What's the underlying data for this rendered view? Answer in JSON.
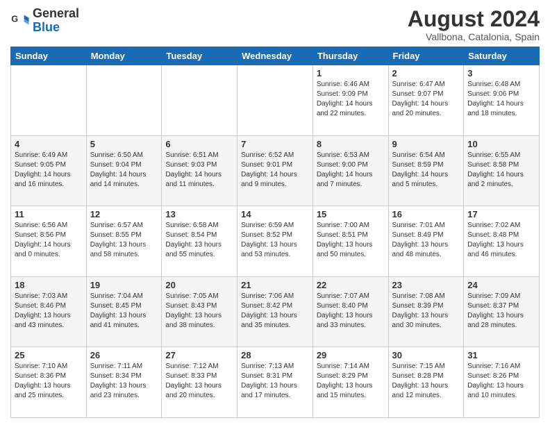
{
  "header": {
    "logo_general": "General",
    "logo_blue": "Blue",
    "month_title": "August 2024",
    "location": "Vallbona, Catalonia, Spain"
  },
  "days_of_week": [
    "Sunday",
    "Monday",
    "Tuesday",
    "Wednesday",
    "Thursday",
    "Friday",
    "Saturday"
  ],
  "weeks": [
    [
      {
        "day": "",
        "info": ""
      },
      {
        "day": "",
        "info": ""
      },
      {
        "day": "",
        "info": ""
      },
      {
        "day": "",
        "info": ""
      },
      {
        "day": "1",
        "info": "Sunrise: 6:46 AM\nSunset: 9:09 PM\nDaylight: 14 hours and 22 minutes."
      },
      {
        "day": "2",
        "info": "Sunrise: 6:47 AM\nSunset: 9:07 PM\nDaylight: 14 hours and 20 minutes."
      },
      {
        "day": "3",
        "info": "Sunrise: 6:48 AM\nSunset: 9:06 PM\nDaylight: 14 hours and 18 minutes."
      }
    ],
    [
      {
        "day": "4",
        "info": "Sunrise: 6:49 AM\nSunset: 9:05 PM\nDaylight: 14 hours and 16 minutes."
      },
      {
        "day": "5",
        "info": "Sunrise: 6:50 AM\nSunset: 9:04 PM\nDaylight: 14 hours and 14 minutes."
      },
      {
        "day": "6",
        "info": "Sunrise: 6:51 AM\nSunset: 9:03 PM\nDaylight: 14 hours and 11 minutes."
      },
      {
        "day": "7",
        "info": "Sunrise: 6:52 AM\nSunset: 9:01 PM\nDaylight: 14 hours and 9 minutes."
      },
      {
        "day": "8",
        "info": "Sunrise: 6:53 AM\nSunset: 9:00 PM\nDaylight: 14 hours and 7 minutes."
      },
      {
        "day": "9",
        "info": "Sunrise: 6:54 AM\nSunset: 8:59 PM\nDaylight: 14 hours and 5 minutes."
      },
      {
        "day": "10",
        "info": "Sunrise: 6:55 AM\nSunset: 8:58 PM\nDaylight: 14 hours and 2 minutes."
      }
    ],
    [
      {
        "day": "11",
        "info": "Sunrise: 6:56 AM\nSunset: 8:56 PM\nDaylight: 14 hours and 0 minutes."
      },
      {
        "day": "12",
        "info": "Sunrise: 6:57 AM\nSunset: 8:55 PM\nDaylight: 13 hours and 58 minutes."
      },
      {
        "day": "13",
        "info": "Sunrise: 6:58 AM\nSunset: 8:54 PM\nDaylight: 13 hours and 55 minutes."
      },
      {
        "day": "14",
        "info": "Sunrise: 6:59 AM\nSunset: 8:52 PM\nDaylight: 13 hours and 53 minutes."
      },
      {
        "day": "15",
        "info": "Sunrise: 7:00 AM\nSunset: 8:51 PM\nDaylight: 13 hours and 50 minutes."
      },
      {
        "day": "16",
        "info": "Sunrise: 7:01 AM\nSunset: 8:49 PM\nDaylight: 13 hours and 48 minutes."
      },
      {
        "day": "17",
        "info": "Sunrise: 7:02 AM\nSunset: 8:48 PM\nDaylight: 13 hours and 46 minutes."
      }
    ],
    [
      {
        "day": "18",
        "info": "Sunrise: 7:03 AM\nSunset: 8:46 PM\nDaylight: 13 hours and 43 minutes."
      },
      {
        "day": "19",
        "info": "Sunrise: 7:04 AM\nSunset: 8:45 PM\nDaylight: 13 hours and 41 minutes."
      },
      {
        "day": "20",
        "info": "Sunrise: 7:05 AM\nSunset: 8:43 PM\nDaylight: 13 hours and 38 minutes."
      },
      {
        "day": "21",
        "info": "Sunrise: 7:06 AM\nSunset: 8:42 PM\nDaylight: 13 hours and 35 minutes."
      },
      {
        "day": "22",
        "info": "Sunrise: 7:07 AM\nSunset: 8:40 PM\nDaylight: 13 hours and 33 minutes."
      },
      {
        "day": "23",
        "info": "Sunrise: 7:08 AM\nSunset: 8:39 PM\nDaylight: 13 hours and 30 minutes."
      },
      {
        "day": "24",
        "info": "Sunrise: 7:09 AM\nSunset: 8:37 PM\nDaylight: 13 hours and 28 minutes."
      }
    ],
    [
      {
        "day": "25",
        "info": "Sunrise: 7:10 AM\nSunset: 8:36 PM\nDaylight: 13 hours and 25 minutes."
      },
      {
        "day": "26",
        "info": "Sunrise: 7:11 AM\nSunset: 8:34 PM\nDaylight: 13 hours and 23 minutes."
      },
      {
        "day": "27",
        "info": "Sunrise: 7:12 AM\nSunset: 8:33 PM\nDaylight: 13 hours and 20 minutes."
      },
      {
        "day": "28",
        "info": "Sunrise: 7:13 AM\nSunset: 8:31 PM\nDaylight: 13 hours and 17 minutes."
      },
      {
        "day": "29",
        "info": "Sunrise: 7:14 AM\nSunset: 8:29 PM\nDaylight: 13 hours and 15 minutes."
      },
      {
        "day": "30",
        "info": "Sunrise: 7:15 AM\nSunset: 8:28 PM\nDaylight: 13 hours and 12 minutes."
      },
      {
        "day": "31",
        "info": "Sunrise: 7:16 AM\nSunset: 8:26 PM\nDaylight: 13 hours and 10 minutes."
      }
    ]
  ]
}
